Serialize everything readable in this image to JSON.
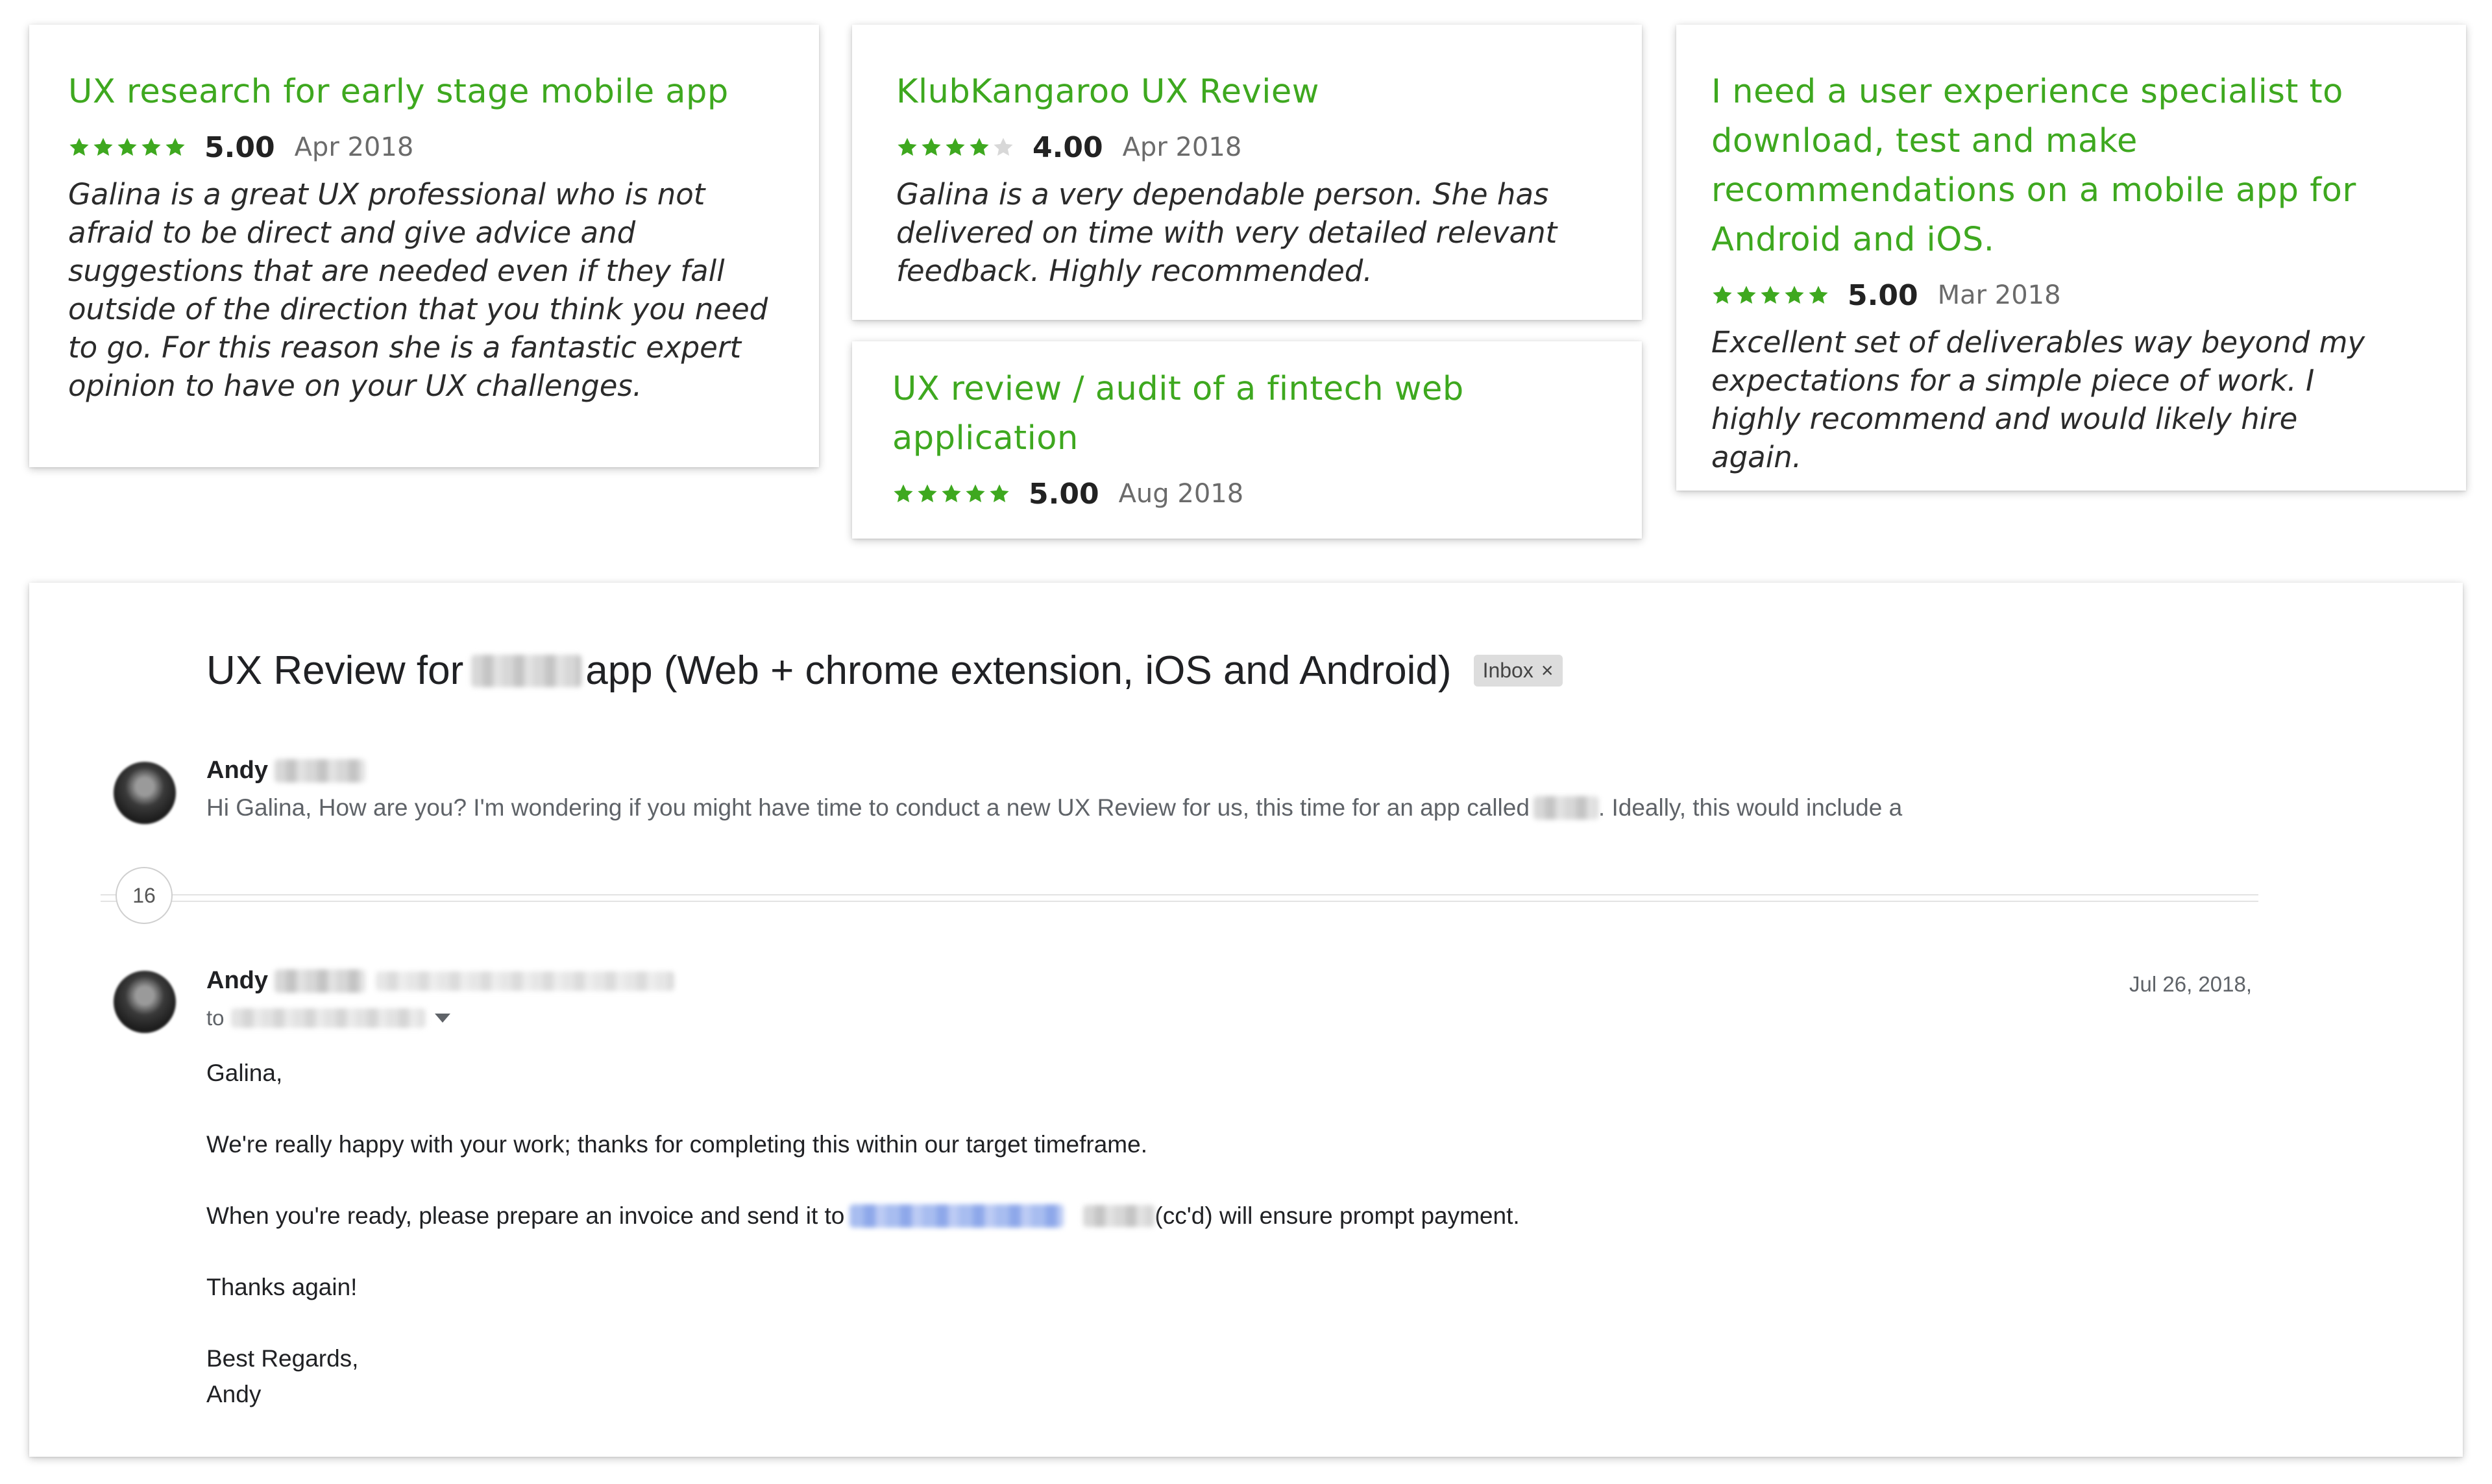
{
  "colors": {
    "accent_green": "#3ea81f",
    "star_green": "#3ea81f",
    "star_empty": "#d8d8d8"
  },
  "reviews": [
    {
      "title": "UX research for early stage mobile app",
      "rating": 5,
      "score": "5.00",
      "date": "Apr 2018",
      "quote": "Galina is a great UX professional who is not afraid to be direct and give advice and suggestions that are needed even if they fall outside of the direction that you think you need to go. For this reason she is a fantastic expert opinion to have on your UX challenges."
    },
    {
      "title": "KlubKangaroo UX Review",
      "rating": 4,
      "score": "4.00",
      "date": "Apr 2018",
      "quote": "Galina is a very dependable person. She has delivered on time with very detailed relevant feedback. Highly recommended."
    },
    {
      "title": "UX review / audit of a fintech web application",
      "rating": 5,
      "score": "5.00",
      "date": "Aug 2018",
      "quote": ""
    },
    {
      "title": "I need a user experience specialist to download, test and make recommendations on a mobile app for Android and iOS.",
      "rating": 5,
      "score": "5.00",
      "date": "Mar 2018",
      "quote": "Excellent set of deliverables way beyond my expectations for a simple piece of work. I highly recommend and would likely hire again."
    }
  ],
  "email": {
    "subject_prefix": "UX Review for",
    "subject_suffix": "app (Web + chrome extension, iOS and Android)",
    "label_chip": "Inbox",
    "label_close": "×",
    "collapsed": {
      "sender": "Andy",
      "snippet_before": "Hi Galina, How are you? I'm wondering if you might have time to conduct a new UX Review for us, this time for an app called",
      "snippet_after": ". Ideally, this would include a"
    },
    "hidden_count": "16",
    "message": {
      "sender": "Andy",
      "to_label": "to",
      "date": "Jul 26, 2018,",
      "greeting": "Galina,",
      "line1": "We're really happy with your work; thanks for completing this within our target timeframe.",
      "line2_before": "When you're ready, please prepare an invoice and send it to",
      "line2_after": "(cc'd) will ensure prompt payment.",
      "thanks": "Thanks again!",
      "signoff": "Best Regards,",
      "signature": "Andy"
    }
  }
}
